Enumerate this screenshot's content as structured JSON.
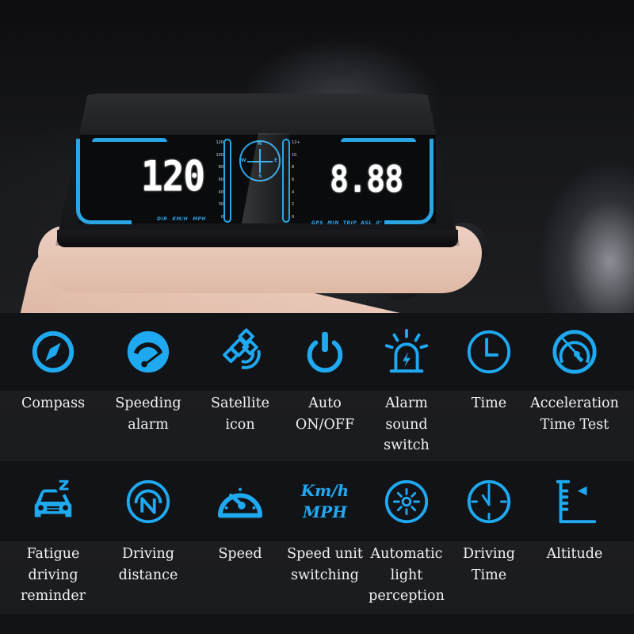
{
  "hud_display": {
    "speed_value": "120",
    "speed_labels": [
      "DIR",
      "KM/H",
      "MPH"
    ],
    "speed_scale_ticks": [
      "120",
      "100",
      "80",
      "60",
      "40",
      "30",
      "0"
    ],
    "compass_letters": {
      "n": "N",
      "e": "E",
      "s": "S",
      "w": "W"
    },
    "rpm_scale_ticks": [
      "12+",
      "10",
      "8",
      "6",
      "4",
      "2",
      "0"
    ],
    "right_value": "8.88",
    "right_labels": [
      "GPS",
      "MIN",
      "TRIP",
      "ASL",
      "0°"
    ]
  },
  "accent_color": "#1fa9f0",
  "features_row1": [
    {
      "icon": "compass-icon",
      "label_lines": [
        "Compass"
      ]
    },
    {
      "icon": "speedometer-alarm-icon",
      "label_lines": [
        "Speeding",
        "alarm"
      ]
    },
    {
      "icon": "satellite-icon",
      "label_lines": [
        "Satellite",
        "icon"
      ]
    },
    {
      "icon": "power-icon",
      "label_lines": [
        "Auto",
        "ON/OFF"
      ]
    },
    {
      "icon": "siren-icon",
      "label_lines": [
        "Alarm",
        "sound",
        "switch"
      ]
    },
    {
      "icon": "clock-icon",
      "label_lines": [
        "Time"
      ]
    },
    {
      "icon": "acceleration-gauge-icon",
      "label_lines": [
        "Acceleration",
        "Time Test"
      ]
    }
  ],
  "features_row2": [
    {
      "icon": "sleepy-car-icon",
      "label_lines": [
        "Fatigue",
        "driving",
        "reminder"
      ]
    },
    {
      "icon": "north-distance-icon",
      "label_lines": [
        "Driving",
        "distance"
      ]
    },
    {
      "icon": "speedometer-icon",
      "label_lines": [
        "Speed"
      ]
    },
    {
      "icon": "unit-text-icon",
      "unit_text": [
        "Km/h",
        "MPH"
      ],
      "label_lines": [
        "Speed unit",
        "switching"
      ]
    },
    {
      "icon": "light-sensor-icon",
      "label_lines": [
        "Automatic",
        "light",
        "perception"
      ]
    },
    {
      "icon": "stopwatch-icon",
      "label_lines": [
        "Driving",
        "Time"
      ]
    },
    {
      "icon": "altitude-icon",
      "label_lines": [
        "Altitude"
      ]
    }
  ]
}
